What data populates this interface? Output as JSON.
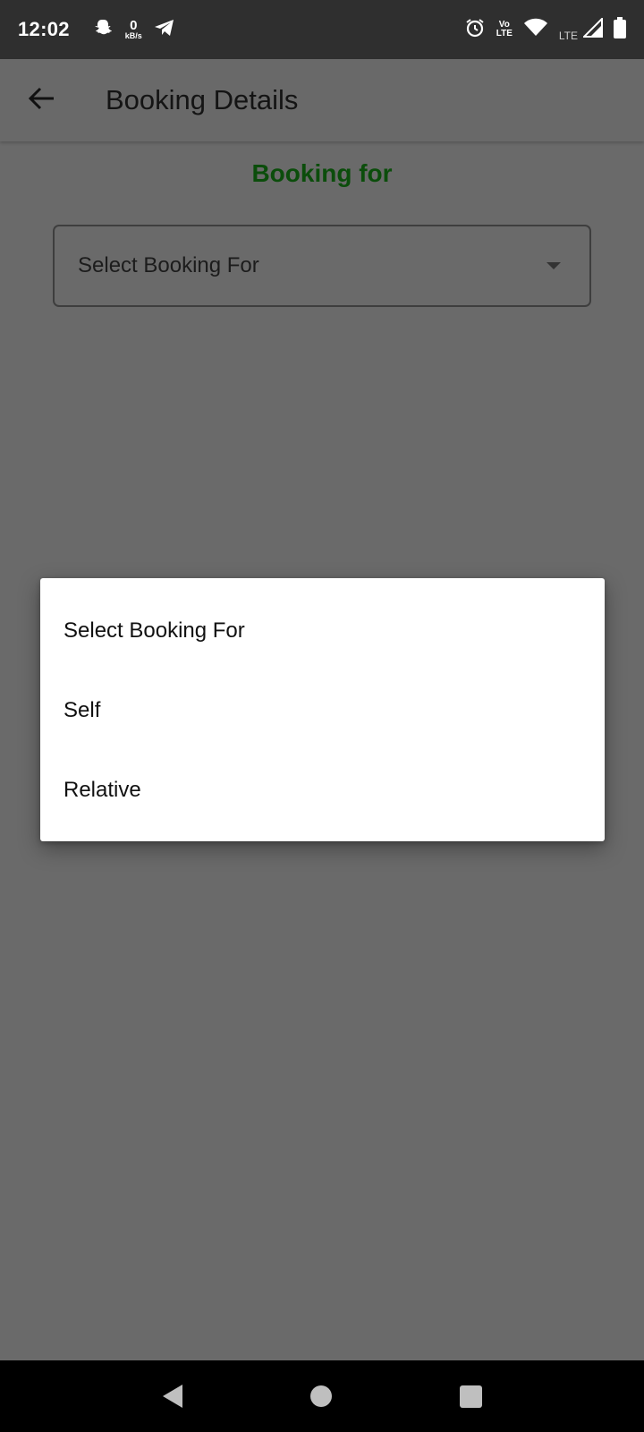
{
  "status_bar": {
    "time": "12:02",
    "speed_value": "0",
    "speed_unit": "kB/s",
    "volte_top": "Vo",
    "volte_bottom": "LTE",
    "lte_label": "LTE",
    "icons": [
      "snapchat-icon",
      "telegram-icon",
      "alarm-icon",
      "volte-icon",
      "wifi-icon",
      "signal-icon",
      "battery-icon"
    ]
  },
  "app_bar": {
    "title": "Booking Details",
    "back_icon": "arrow-back-icon"
  },
  "form": {
    "section_title": "Booking for",
    "select_value": "Select Booking For"
  },
  "menu": {
    "items": [
      {
        "label": "Select Booking For"
      },
      {
        "label": "Self"
      },
      {
        "label": "Relative"
      }
    ]
  },
  "colors": {
    "section_title": "#0b4d0b",
    "scrim": "#6a6a6a",
    "status_bar": "#2f2f2f",
    "menu_bg": "#ffffff"
  }
}
